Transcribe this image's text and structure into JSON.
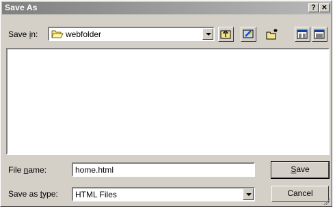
{
  "window": {
    "title": "Save As"
  },
  "caption_buttons": {
    "help": "?",
    "close": "✕"
  },
  "save_in": {
    "label_pre": "Save ",
    "label_accel": "i",
    "label_post": "n:",
    "value": "webfolder",
    "icon": "folder-open-icon"
  },
  "toolbar": {
    "items": [
      {
        "name": "up-one-level-button",
        "icon": "folder-up-icon"
      },
      {
        "name": "desktop-button",
        "icon": "desktop-icon"
      },
      {
        "name": "new-folder-button",
        "icon": "new-folder-icon"
      },
      {
        "name": "list-view-button",
        "icon": "list-view-icon"
      },
      {
        "name": "details-view-button",
        "icon": "details-view-icon"
      }
    ]
  },
  "file_list": {
    "items": []
  },
  "file_name": {
    "label_pre": "File ",
    "label_accel": "n",
    "label_post": "ame:",
    "value": "home.html"
  },
  "save_as_type": {
    "label_pre": "Save as ",
    "label_accel": "t",
    "label_post": "ype:",
    "value": "HTML Files"
  },
  "buttons": {
    "save_accel": "S",
    "save_rest": "ave",
    "cancel": "Cancel"
  },
  "colors": {
    "face": "#d4d0c8",
    "titlebar": "#808080",
    "window": "#ffffff"
  }
}
